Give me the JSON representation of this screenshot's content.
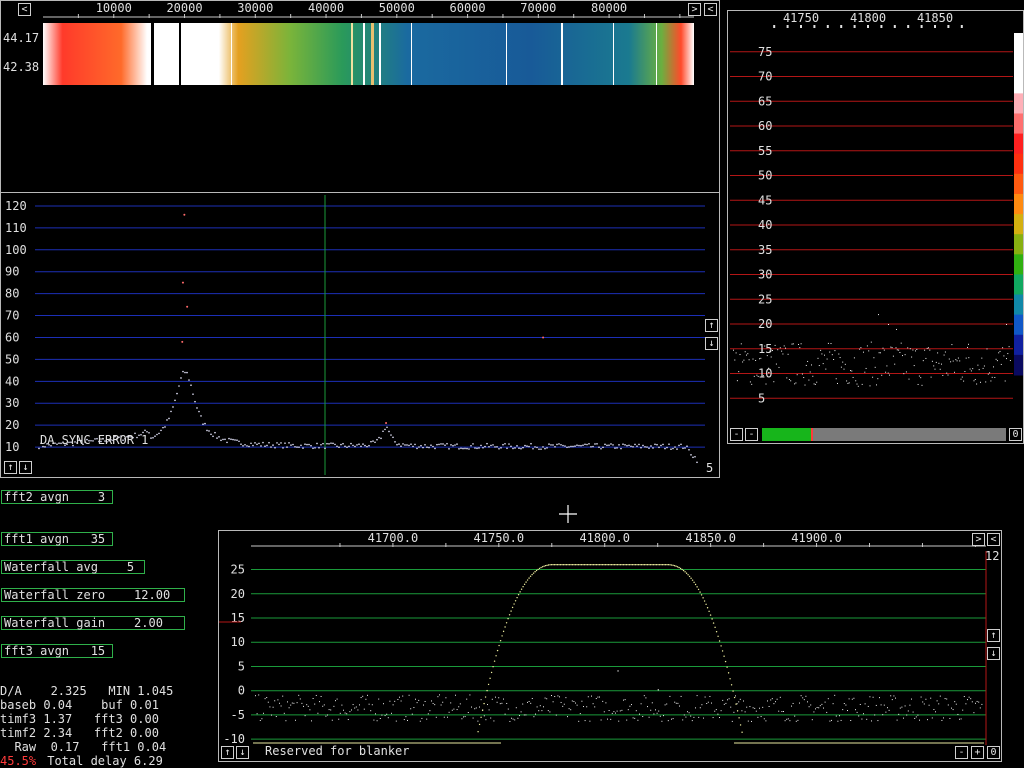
{
  "colors": {
    "grid_blue": "#1c2fb6",
    "grid_red": "#b31616",
    "grid_green": "#1a9a3a",
    "param_border": "#2fb04a",
    "accent_red": "#ff3b3b"
  },
  "waterfall": {
    "freq_ticks": [
      {
        "v": 10000,
        "label": "10000"
      },
      {
        "v": 20000,
        "label": "20000"
      },
      {
        "v": 30000,
        "label": "30000"
      },
      {
        "v": 40000,
        "label": "40000"
      },
      {
        "v": 50000,
        "label": "50000"
      },
      {
        "v": 60000,
        "label": "60000"
      },
      {
        "v": 70000,
        "label": "70000"
      },
      {
        "v": 80000,
        "label": "80000"
      }
    ],
    "time_labels": [
      "44.17",
      "42.38"
    ],
    "left_arrow": "<",
    "right_arrow": ">",
    "close": "<"
  },
  "spectrum": {
    "y_ticks": [
      10,
      20,
      30,
      40,
      50,
      60,
      70,
      80,
      90,
      100,
      110,
      120
    ],
    "y_range": [
      0,
      125
    ],
    "x_range": [
      0,
      96000
    ],
    "status_text": "DA SYNC ERROR  1",
    "right_value": "5",
    "up": "↑",
    "down": "↓"
  },
  "hires": {
    "freq_ticks": [
      {
        "v": 41750,
        "label": "41750"
      },
      {
        "v": 41800,
        "label": "41800"
      },
      {
        "v": 41850,
        "label": "41850"
      }
    ],
    "y_ticks": [
      5,
      10,
      15,
      20,
      25,
      30,
      35,
      40,
      45,
      50,
      55,
      60,
      65,
      70,
      75
    ],
    "y_range": [
      0,
      80
    ],
    "minus": "-",
    "zero": "0",
    "progress": 0.2
  },
  "params": [
    {
      "name": "fft2-avgn",
      "label": "fft2 avgn    3"
    },
    {
      "name": "fft1-avgn",
      "label": "fft1 avgn   35"
    },
    {
      "name": "waterfall-avg",
      "label": "Waterfall avg    5"
    },
    {
      "name": "waterfall-zero",
      "label": "Waterfall zero    12.00"
    },
    {
      "name": "waterfall-gain",
      "label": "Waterfall gain    2.00"
    },
    {
      "name": "fft3-avgn",
      "label": "fft3 avgn   15"
    }
  ],
  "stats": {
    "line1": "D/A    2.325   MIN 1.045",
    "line2": "baseb 0.04    buf 0.01",
    "line3": "timf3 1.37   fft3 0.00",
    "line4": "timf2 2.34   fft2 0.00",
    "line5": "  Raw  0.17   fft1 0.04",
    "cpu": "45.5%",
    "total": " Total delay 6.29"
  },
  "baseband": {
    "freq_ticks": [
      {
        "v": 41700,
        "label": "41700.0"
      },
      {
        "v": 41750,
        "label": "41750.0"
      },
      {
        "v": 41800,
        "label": "41800.0"
      },
      {
        "v": 41850,
        "label": "41850.0"
      },
      {
        "v": 41900,
        "label": "41900.0"
      }
    ],
    "y_ticks": [
      -10,
      -5,
      0,
      5,
      10,
      15,
      20,
      25
    ],
    "y_range": [
      -11,
      28
    ],
    "x_range": [
      41633,
      41980
    ],
    "right_value": "12",
    "status_text": "Reserved for blanker",
    "minus": "-",
    "plus": "+",
    "zero": "0",
    "right_arrow": ">",
    "close": "<",
    "up": "↑",
    "down": "↓"
  }
}
